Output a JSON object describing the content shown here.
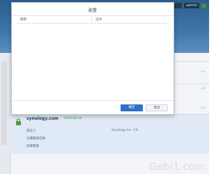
{
  "topbar": {
    "user_label": "admin"
  },
  "dialog": {
    "title": "配置",
    "columns": {
      "service": "服務",
      "certificate": "证书"
    },
    "ok_label": "确定",
    "cancel_label": "取消"
  },
  "cert": {
    "domain": "synology.com",
    "date": " - 2019-08-19",
    "rows": [
      {
        "label": "簽证人",
        "value": "Synology Inc. CA"
      },
      {
        "label": "主體備選名稱",
        "value": "-"
      },
      {
        "label": "佈署範圍",
        "value": "-"
      }
    ]
  },
  "watermark": "Gebi1.com",
  "colors": {
    "accent": "#2f6fc9",
    "valid_green": "#4e9b3a",
    "panel_bg": "#dfeaf6"
  }
}
